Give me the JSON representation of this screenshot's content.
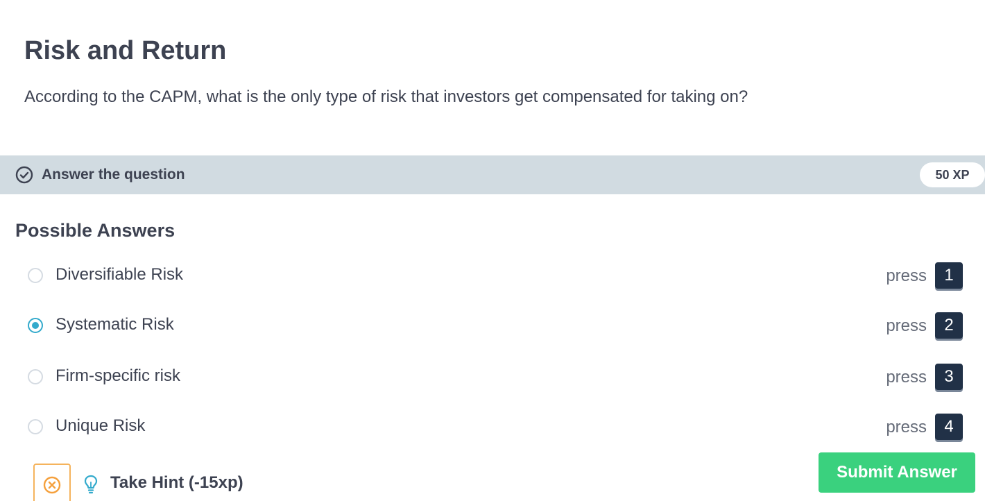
{
  "exercise": {
    "title": "Risk and Return",
    "question": "According to the CAPM, what is the only type of risk that investors get compensated for taking on?"
  },
  "task": {
    "label": "Answer the question",
    "xp": "50 XP",
    "icon": "check-circle-icon"
  },
  "answers": {
    "heading": "Possible Answers",
    "press_label": "press",
    "selected_index": 1,
    "items": [
      {
        "label": "Diversifiable Risk",
        "key": "1"
      },
      {
        "label": "Systematic Risk",
        "key": "2"
      },
      {
        "label": "Firm-specific risk",
        "key": "3"
      },
      {
        "label": "Unique Risk",
        "key": "4"
      }
    ]
  },
  "hint": {
    "label": "Take Hint (-15xp)",
    "icon": "lightbulb-icon"
  },
  "submit": {
    "label": "Submit Answer"
  },
  "colors": {
    "accent": "#33aacc",
    "submit": "#3ad17e",
    "task_bar": "#d1dbe1",
    "key_badge": "#213147",
    "hint_border": "#f5b35c"
  }
}
